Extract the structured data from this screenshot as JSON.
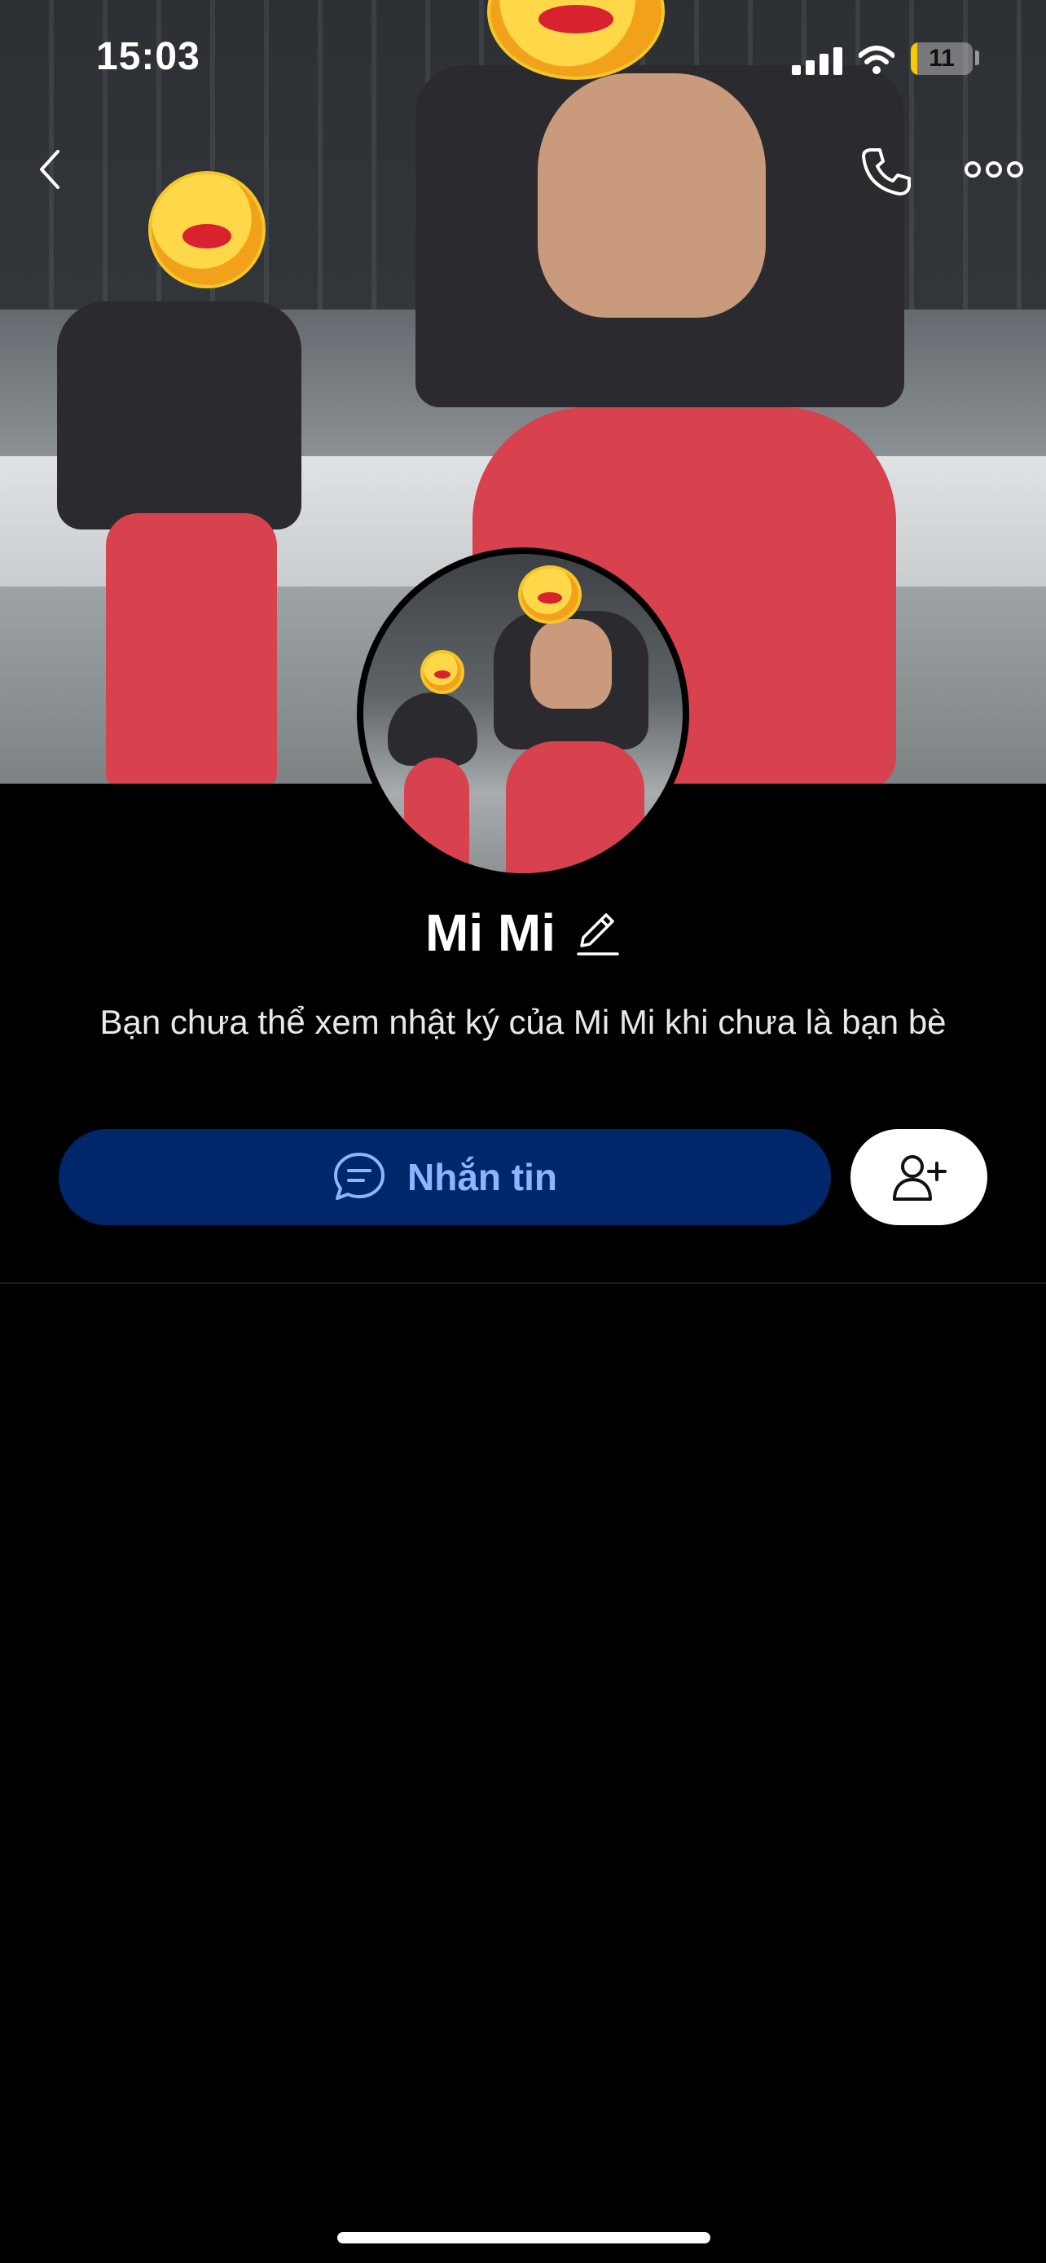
{
  "status_bar": {
    "time": "15:03",
    "battery_level": "11",
    "battery_fraction": 0.11
  },
  "nav": {
    "back_icon": "chevron-left-icon",
    "call_icon": "phone-icon",
    "more_icon": "more-dots-icon"
  },
  "profile": {
    "name": "Mi Mi",
    "edit_icon": "pencil-icon",
    "privacy_message": "Bạn chưa thể xem nhật ký của Mi Mi khi chưa là bạn bè"
  },
  "actions": {
    "message_label": "Nhắn tin",
    "message_icon": "chat-bubble-icon",
    "add_friend_icon": "add-friend-icon"
  },
  "colors": {
    "message_button_bg": "#00276a",
    "message_button_text": "#8fb4ff",
    "battery_fill": "#f7c900"
  }
}
